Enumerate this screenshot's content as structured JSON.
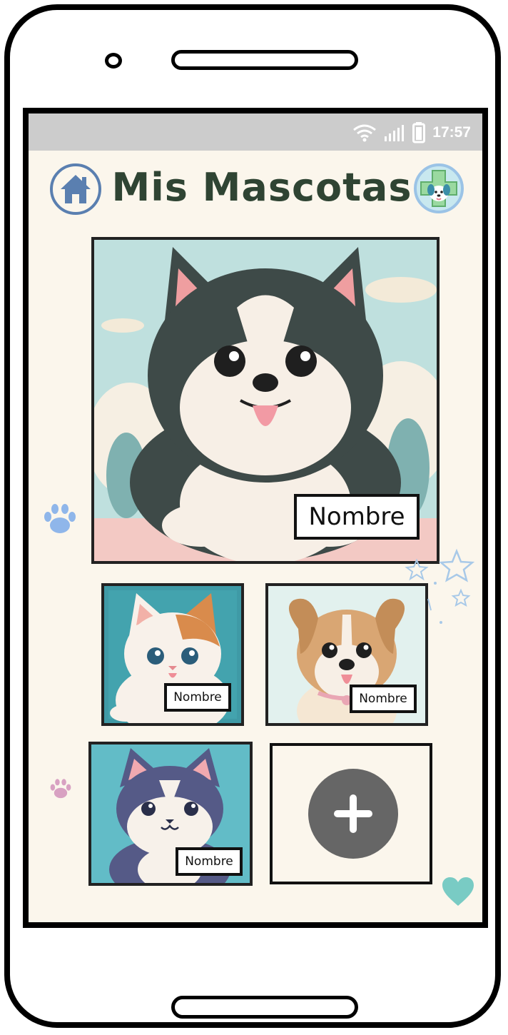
{
  "status_bar": {
    "time": "17:57"
  },
  "header": {
    "title": "Mis Mascotas"
  },
  "pets": [
    {
      "name": "Nombre"
    },
    {
      "name": "Nombre"
    },
    {
      "name": "Nombre"
    },
    {
      "name": "Nombre"
    }
  ],
  "colors": {
    "background": "#fbf6ec",
    "title": "#2f4433",
    "home_icon": "#5a7fb0",
    "add_button": "#666666"
  },
  "icons": {
    "home": "home-icon",
    "vet": "vet-cross-icon",
    "add": "plus-icon"
  }
}
